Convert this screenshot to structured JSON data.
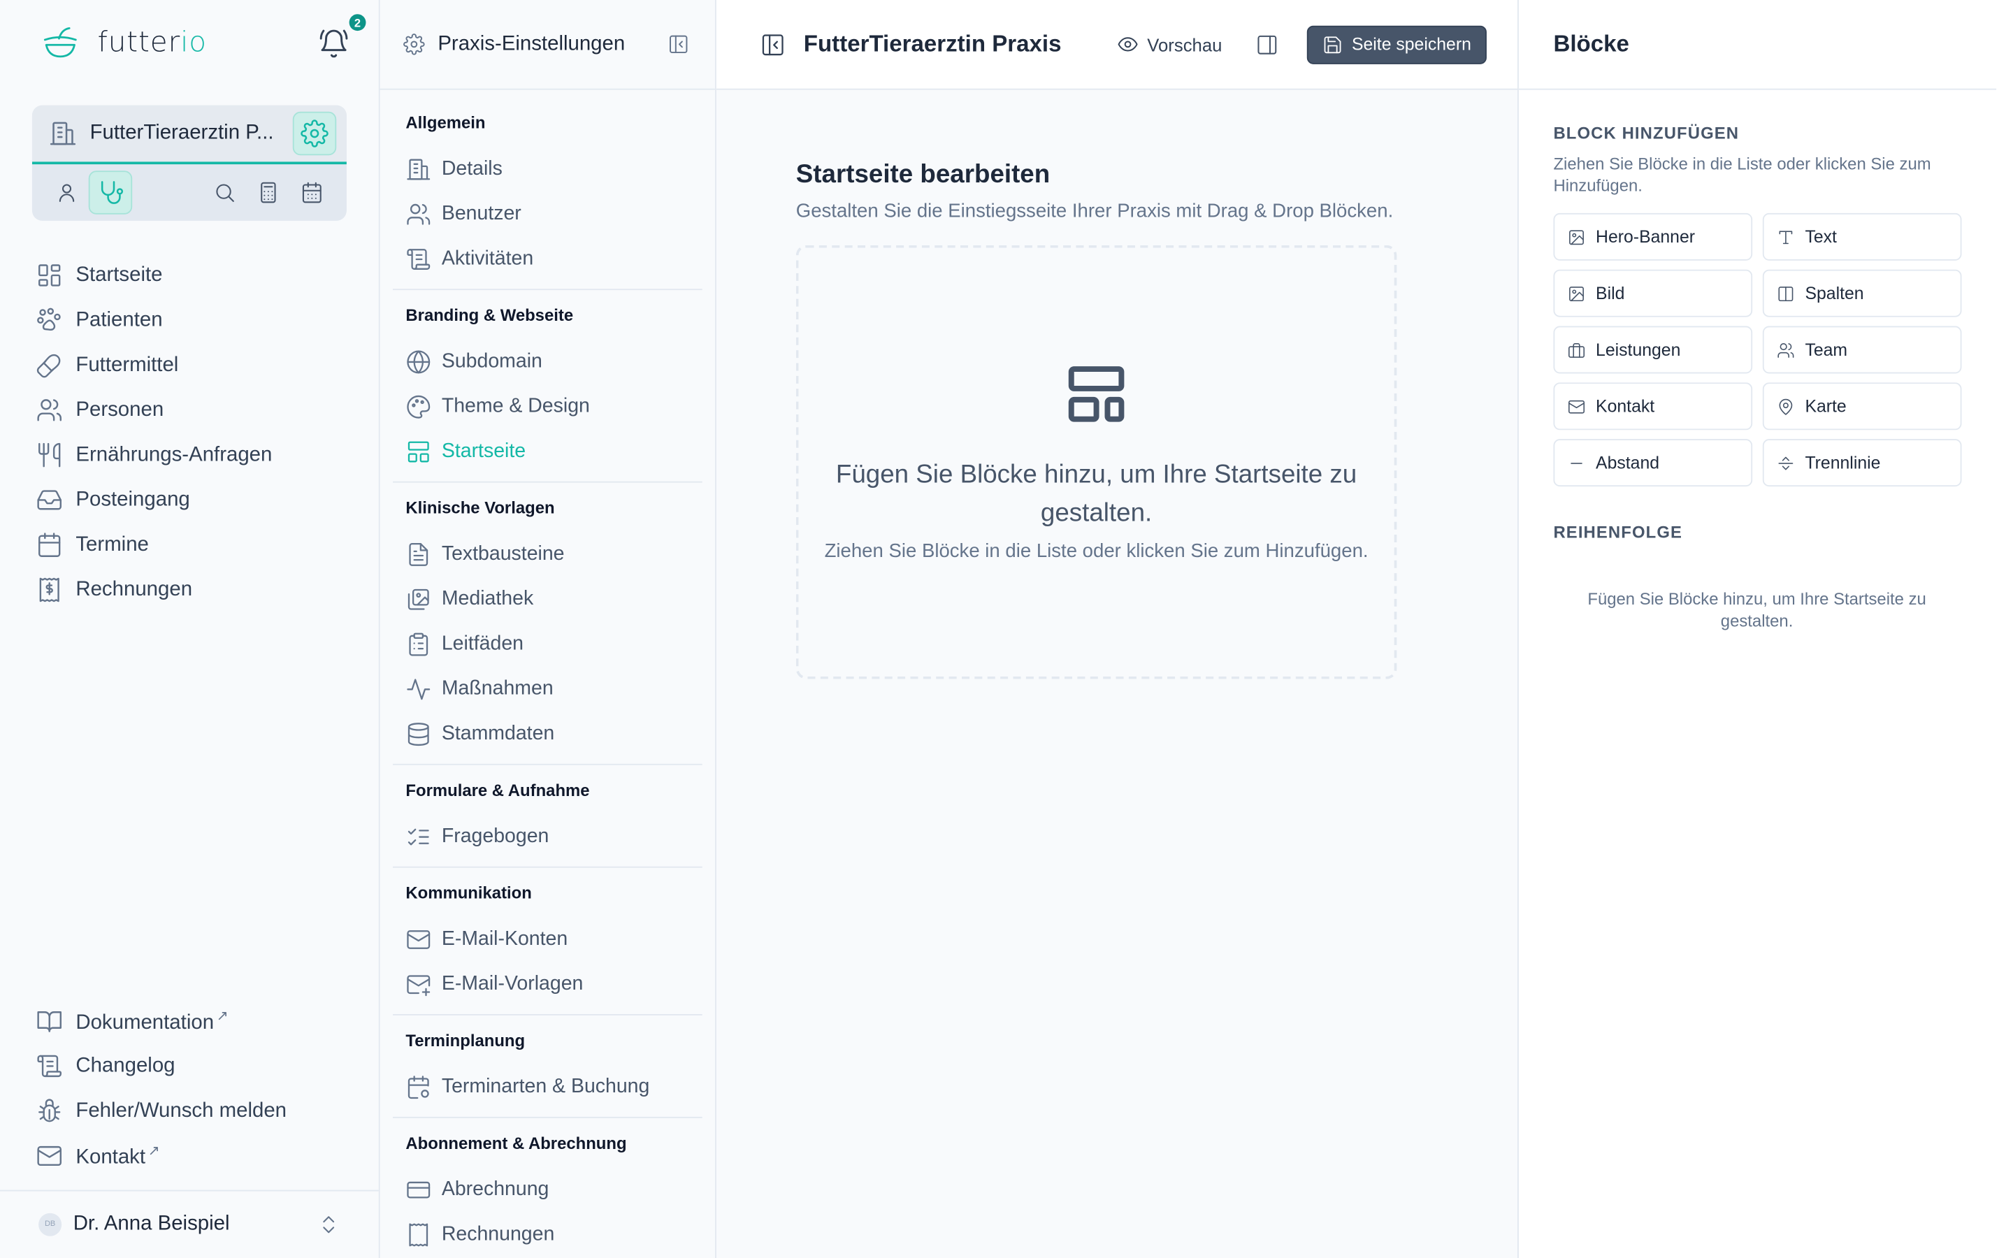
{
  "brand": {
    "name_part1": "futter",
    "name_part2": "io",
    "notification_count": "2"
  },
  "practice": {
    "name": "FutterTieraerztin P..."
  },
  "main_nav": [
    {
      "label": "Startseite",
      "icon": "dashboard-icon"
    },
    {
      "label": "Patienten",
      "icon": "paw-icon"
    },
    {
      "label": "Futtermittel",
      "icon": "food-icon"
    },
    {
      "label": "Personen",
      "icon": "users-icon"
    },
    {
      "label": "Ernährungs-Anfragen",
      "icon": "utensils-icon"
    },
    {
      "label": "Posteingang",
      "icon": "inbox-icon"
    },
    {
      "label": "Termine",
      "icon": "calendar-icon"
    },
    {
      "label": "Rechnungen",
      "icon": "invoice-icon"
    }
  ],
  "bottom_nav": [
    {
      "label": "Dokumentation",
      "ext": "↗"
    },
    {
      "label": "Changelog",
      "ext": ""
    },
    {
      "label": "Fehler/Wunsch melden",
      "ext": ""
    },
    {
      "label": "Kontakt",
      "ext": "↗"
    }
  ],
  "user": {
    "initials": "DB",
    "name": "Dr. Anna Beispiel"
  },
  "settings": {
    "title": "Praxis-Einstellungen",
    "sections": [
      {
        "heading": "Allgemein",
        "items": [
          "Details",
          "Benutzer",
          "Aktivitäten"
        ]
      },
      {
        "heading": "Branding & Webseite",
        "items": [
          "Subdomain",
          "Theme & Design",
          "Startseite"
        ]
      },
      {
        "heading": "Klinische Vorlagen",
        "items": [
          "Textbausteine",
          "Mediathek",
          "Leitfäden",
          "Maßnahmen",
          "Stammdaten"
        ]
      },
      {
        "heading": "Formulare & Aufnahme",
        "items": [
          "Fragebogen"
        ]
      },
      {
        "heading": "Kommunikation",
        "items": [
          "E-Mail-Konten",
          "E-Mail-Vorlagen"
        ]
      },
      {
        "heading": "Terminplanung",
        "items": [
          "Terminarten & Buchung"
        ]
      },
      {
        "heading": "Abonnement & Abrechnung",
        "items": [
          "Abrechnung",
          "Rechnungen"
        ]
      }
    ]
  },
  "editor": {
    "title": "FutterTieraerztin Praxis",
    "preview_label": "Vorschau",
    "save_label": "Seite speichern",
    "heading": "Startseite bearbeiten",
    "subheading": "Gestalten Sie die Einstiegsseite Ihrer Praxis mit Drag & Drop Blöcken.",
    "empty_title": "Fügen Sie Blöcke hinzu, um Ihre Startseite zu gestalten.",
    "empty_sub": "Ziehen Sie Blöcke in die Liste oder klicken Sie zum Hinzufügen."
  },
  "blocks": {
    "title": "Blöcke",
    "add_heading": "Block hinzufügen",
    "add_hint": "Ziehen Sie Blöcke in die Liste oder klicken Sie zum Hinzufügen.",
    "items": [
      "Hero-Banner",
      "Text",
      "Bild",
      "Spalten",
      "Leistungen",
      "Team",
      "Kontakt",
      "Karte",
      "Abstand",
      "Trennlinie"
    ],
    "order_heading": "Reihenfolge",
    "order_empty": "Fügen Sie Blöcke hinzu, um Ihre Startseite zu gestalten."
  },
  "colors": {
    "accent": "#14b8a6",
    "save_button": "#475569",
    "text": "#334155"
  }
}
